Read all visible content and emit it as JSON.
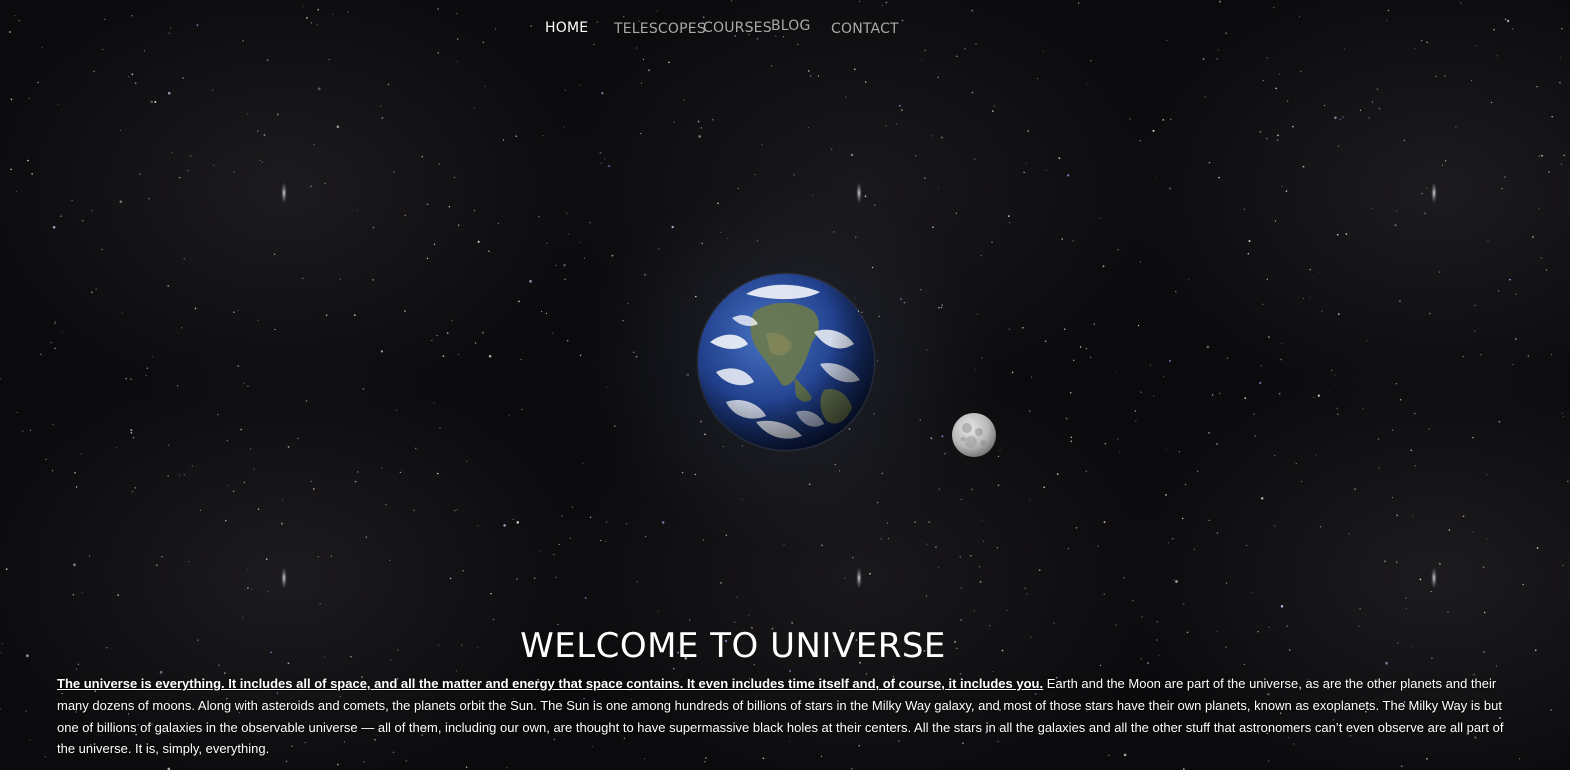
{
  "nav": {
    "items": [
      {
        "label": "HOME",
        "active": true
      },
      {
        "label": "TELESCOPES",
        "active": false
      },
      {
        "label": "COURSES",
        "active": false
      },
      {
        "label": "BLOG",
        "active": false
      },
      {
        "label": "CONTACT",
        "active": false
      }
    ]
  },
  "hero": {
    "title": "WELCOME TO UNIVERSE",
    "lead": "The universe is everything. It includes all of space, and all the matter and energy that space contains. It even includes time itself and, of course, it includes you.",
    "body": " Earth and the Moon are part of the universe, as are the other planets and their many dozens of moons. Along with asteroids and comets, the planets orbit the Sun. The Sun is one among hundreds of billions of stars in the Milky Way galaxy, and most of those stars have their own planets, known as exoplanets. The Milky Way is but one of billions of galaxies in the observable universe — all of them, including our own, are thought to have supermassive black holes at their centers. All the stars in all the galaxies and all the other stuff that astronomers can’t even observe are all part of the universe. It is, simply, everything."
  },
  "colors": {
    "background": "#0b0a0c",
    "nav_active": "#ffffff",
    "nav_inactive": "#a9a9a9",
    "text": "#ffffff"
  },
  "images": {
    "earth": "earth-image",
    "moon": "moon-image",
    "background": "starfield-background"
  }
}
